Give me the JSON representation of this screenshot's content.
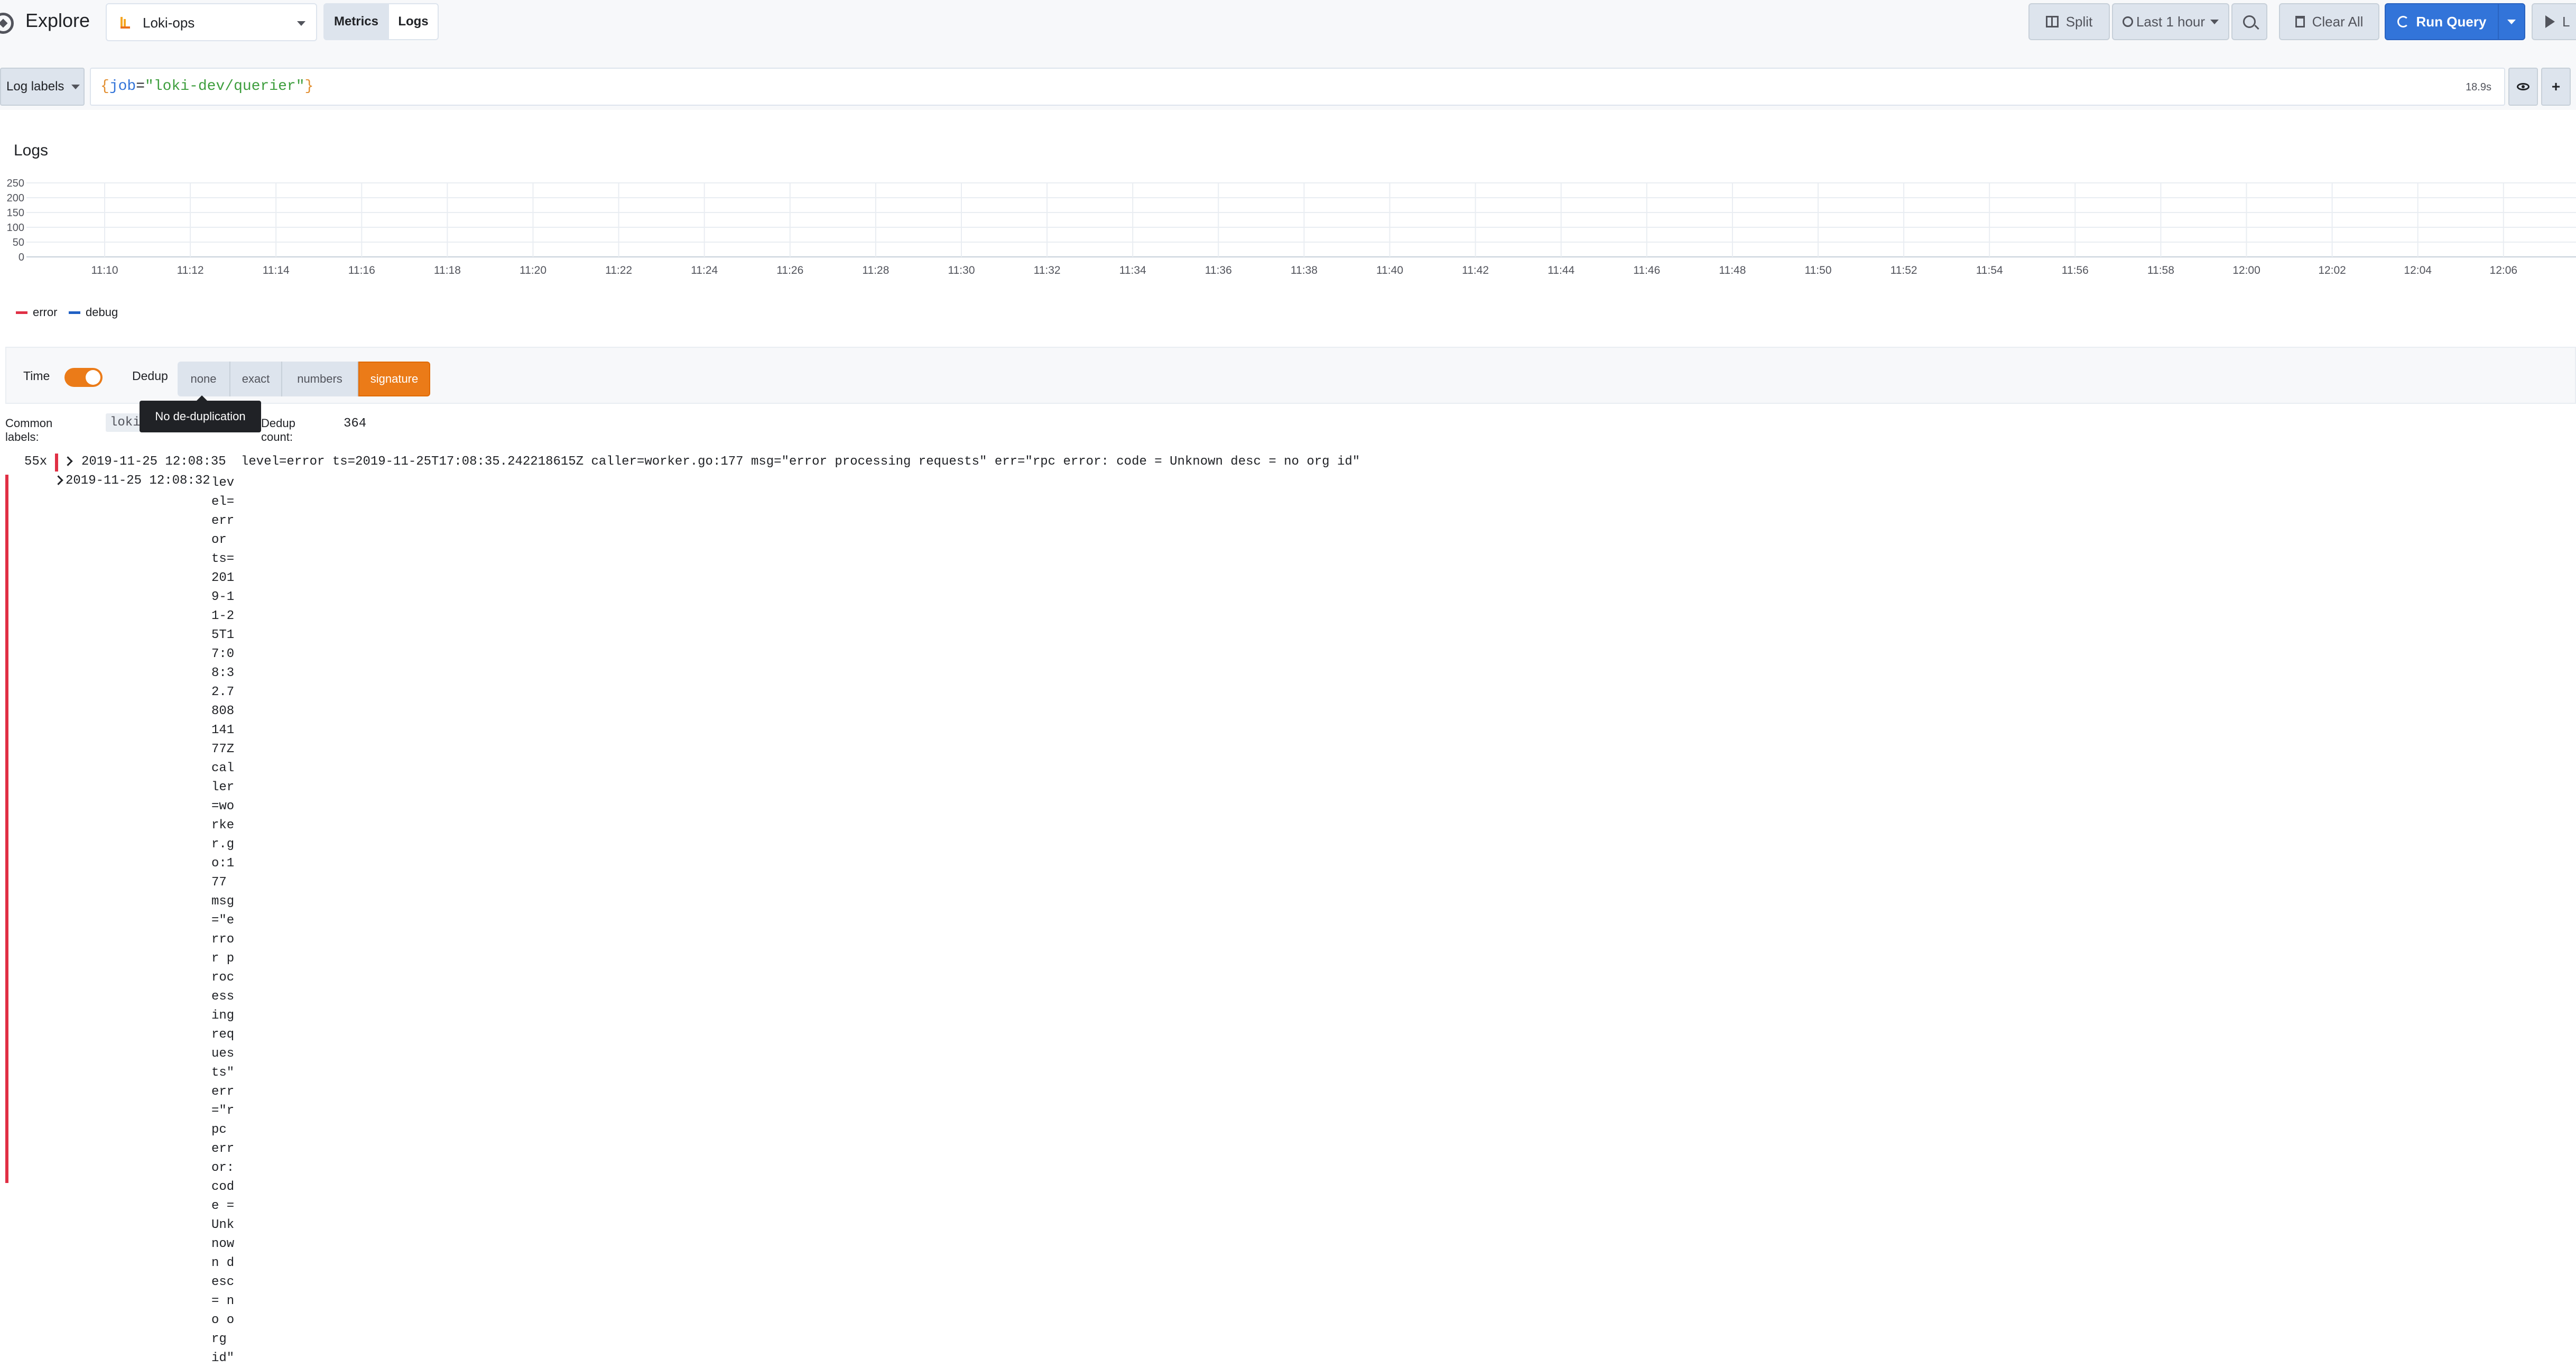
{
  "navbar": {
    "title": "Explore",
    "datasource": "Loki-ops",
    "modes": [
      "Metrics",
      "Logs"
    ],
    "split_label": "Split",
    "time_range": "Last 1 hour",
    "clear_label": "Clear All",
    "run_label": "Run Query",
    "live_label": "L"
  },
  "query": {
    "button_label": "Log labels",
    "open_brace": "{",
    "key": "job",
    "equals": "=",
    "value": "\"loki-dev/querier\"",
    "close_brace": "}",
    "elapsed": "18.9s",
    "add_label": "+"
  },
  "panel": {
    "title": "Logs",
    "legend": [
      {
        "name": "error",
        "color": "#e02f44"
      },
      {
        "name": "debug",
        "color": "#1f60c4"
      }
    ]
  },
  "chart_data": {
    "type": "bar",
    "title": "Logs",
    "xlabel": "",
    "ylabel": "",
    "y_ticks": [
      0,
      50,
      100,
      150,
      200,
      250
    ],
    "ylim": [
      0,
      250
    ],
    "x_ticks": [
      "11:10",
      "11:12",
      "11:14",
      "11:16",
      "11:18",
      "11:20",
      "11:22",
      "11:24",
      "11:26",
      "11:28",
      "11:30",
      "11:32",
      "11:34",
      "11:36",
      "11:38",
      "11:40",
      "11:42",
      "11:44",
      "11:46",
      "11:48",
      "11:50",
      "11:52",
      "11:54",
      "11:56",
      "11:58",
      "12:00",
      "12:02",
      "12:04",
      "12:06"
    ],
    "grid": true,
    "legend_position": "bottom-left",
    "series": [
      {
        "name": "error",
        "values": []
      },
      {
        "name": "debug",
        "values": []
      }
    ]
  },
  "options": {
    "time_label": "Time",
    "time_enabled": true,
    "dedup_label": "Dedup",
    "dedup_options": [
      "none",
      "exact",
      "numbers",
      "signature"
    ],
    "dedup_selected": "signature",
    "tooltip": "No de-duplication",
    "accent_color": "#eb7b18"
  },
  "common": {
    "label": "Common labels:",
    "value": "loki",
    "dedup_count_label": "Dedup count:",
    "dedup_count": "364"
  },
  "rows": [
    {
      "count": "55x",
      "time": "2019-11-25 12:08:35",
      "message": "level=error ts=2019-11-25T17:08:35.242218615Z caller=worker.go:177 msg=\"error processing requests\" err=\"rpc error: code = Unknown desc = no org id\""
    },
    {
      "time": "2019-11-25 12:08:32",
      "message": "level=error ts=2019-11-25T17:08:32.780814177Z caller=worker.go:177 msg=\"error processing requests\" err=\"rpc error: code = Unknown desc = no org id\""
    }
  ]
}
